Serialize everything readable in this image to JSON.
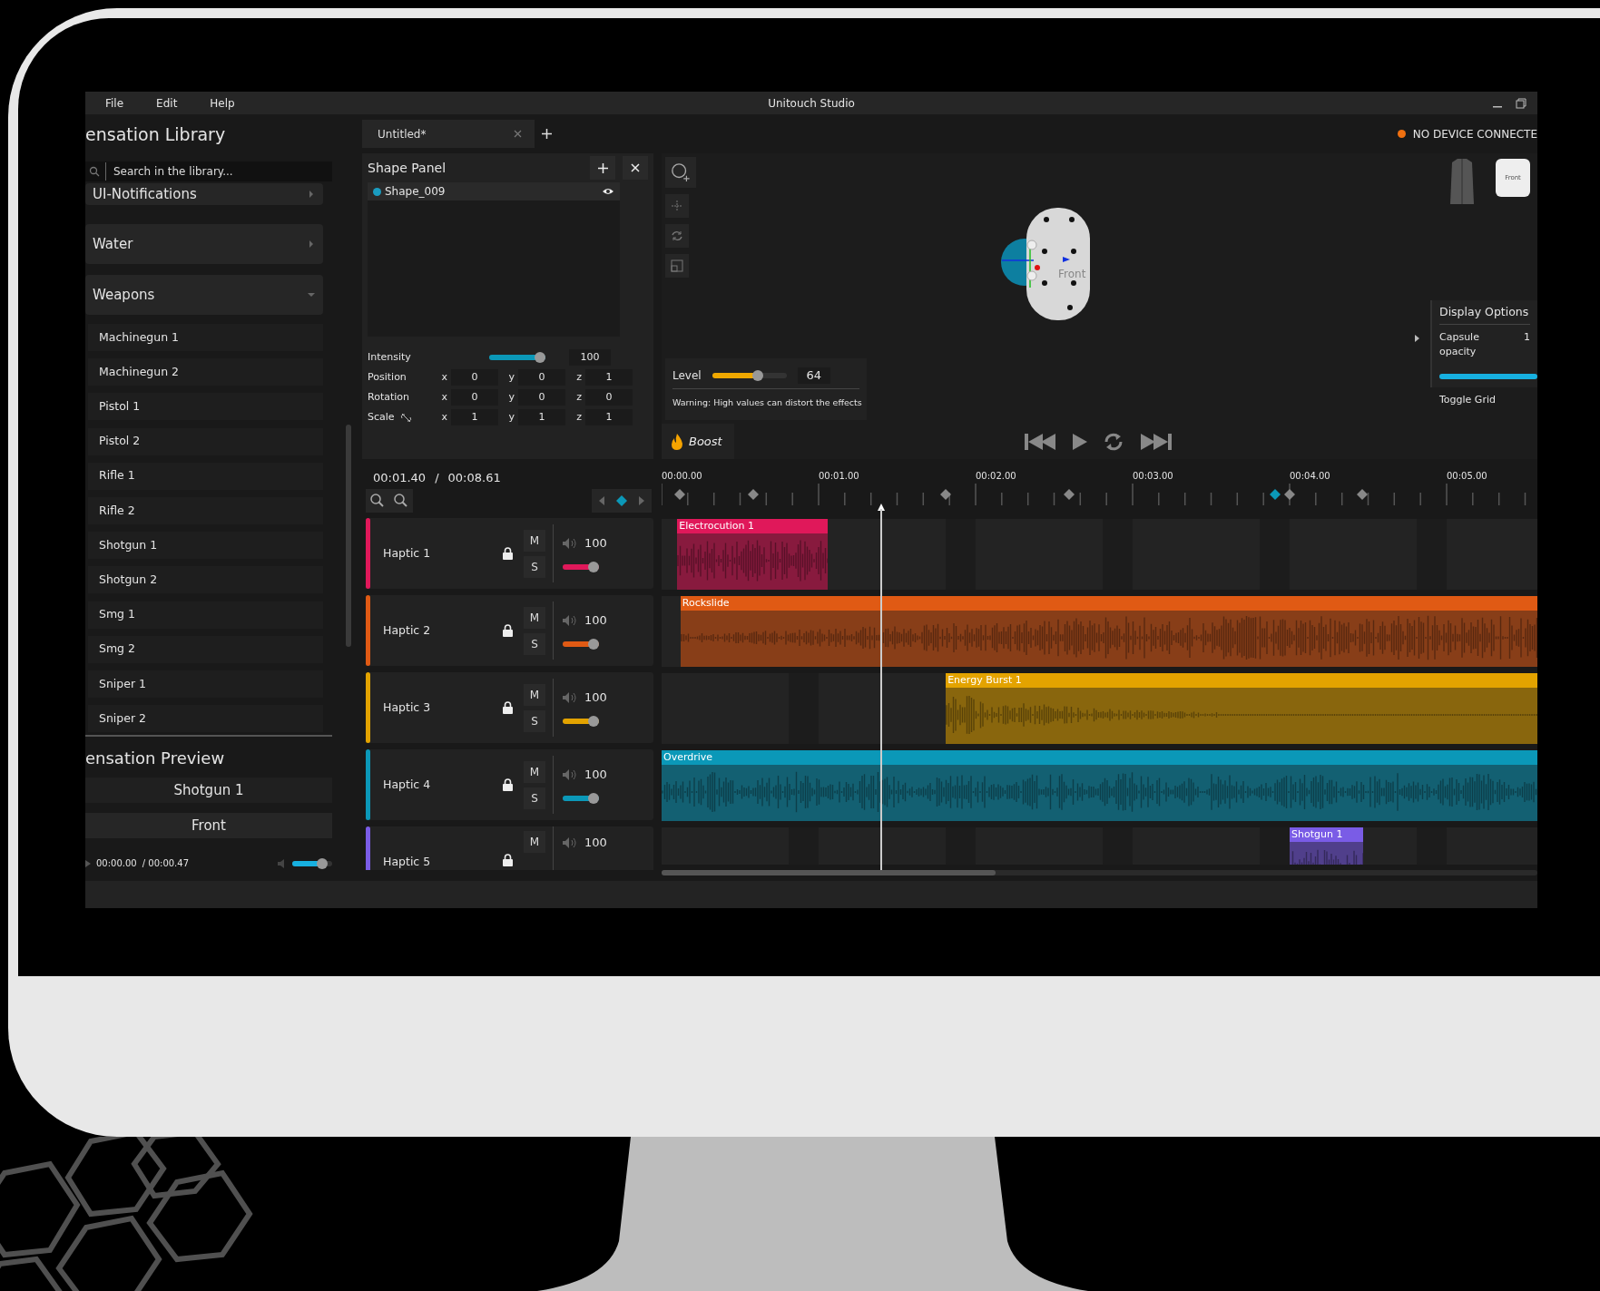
{
  "window": {
    "menu": [
      "File",
      "Edit",
      "Help"
    ],
    "title": "Unitouch Studio"
  },
  "library": {
    "title": "ensation Library",
    "search": {
      "placeholder": "Search in the library..."
    },
    "categories": [
      {
        "label": "UI-Notifications",
        "expanded": false
      },
      {
        "label": "Water",
        "expanded": false
      },
      {
        "label": "Weapons",
        "expanded": true,
        "items": [
          "Machinegun 1",
          "Machinegun 2",
          "Pistol 1",
          "Pistol 2",
          "Rifle 1",
          "Rifle 2",
          "Shotgun 1",
          "Shotgun 2",
          "Smg 1",
          "Smg 2",
          "Sniper 1",
          "Sniper 2"
        ]
      }
    ]
  },
  "preview": {
    "title": "ensation Preview",
    "sensation": "Shotgun 1",
    "view": "Front",
    "time": "00:00.00",
    "duration": "/ 00:00.47",
    "volume": {
      "level": 0.85
    }
  },
  "tabs": [
    {
      "label": "Untitled*",
      "selected": true
    }
  ],
  "device": {
    "label": "NO DEVICE CONNECTE",
    "connected": false
  },
  "shape_panel": {
    "title": "Shape Panel",
    "shapes": [
      {
        "name": "Shape_009",
        "color": "#1a9cc0",
        "visible": true
      }
    ],
    "intensity": {
      "label": "Intensity",
      "level": 1,
      "value": "100"
    },
    "transforms": [
      {
        "label": "Position",
        "values": [
          {
            "axis": "x",
            "value": "0"
          },
          {
            "axis": "y",
            "value": "0"
          },
          {
            "axis": "z",
            "value": "1"
          }
        ]
      },
      {
        "label": "Rotation",
        "values": [
          {
            "axis": "x",
            "value": "0"
          },
          {
            "axis": "y",
            "value": "0"
          },
          {
            "axis": "z",
            "value": "0"
          }
        ]
      },
      {
        "label": "Scale",
        "linked": false,
        "values": [
          {
            "axis": "x",
            "value": "1"
          },
          {
            "axis": "y",
            "value": "1"
          },
          {
            "axis": "z",
            "value": "1"
          }
        ]
      }
    ]
  },
  "viewport": {
    "model_label": "Front",
    "minimap_label": "Front",
    "level": {
      "label": "Level",
      "level": 0.64,
      "value": "64",
      "warning": "Warning: High values can distort the effects"
    },
    "display_options": {
      "title": "Display Options",
      "capsule_opacity": {
        "label": "Capsule opacity",
        "value": "1",
        "level": 1
      },
      "toggle_grid": "Toggle Grid"
    },
    "boost": "Boost"
  },
  "timeline": {
    "current_time": "00:01.40",
    "separator": "/",
    "total_time": "00:08.61",
    "ruler": [
      "00:00.00",
      "00:01.00",
      "00:02.00",
      "00:03.00",
      "00:04.00",
      "00:05.00"
    ],
    "tracks": [
      {
        "name": "Haptic 1",
        "color": "#e0185a",
        "locked": true,
        "mute": "M",
        "solo": "S",
        "volume": "100",
        "level": 1,
        "clip": "Electrocution 1"
      },
      {
        "name": "Haptic 2",
        "color": "#e05a14",
        "locked": true,
        "mute": "M",
        "solo": "S",
        "volume": "100",
        "level": 1,
        "clip": "Rockslide"
      },
      {
        "name": "Haptic 3",
        "color": "#e3a300",
        "locked": true,
        "mute": "M",
        "solo": "S",
        "volume": "100",
        "level": 1,
        "clip": "Energy Burst 1"
      },
      {
        "name": "Haptic 4",
        "color": "#0b98b8",
        "locked": true,
        "mute": "M",
        "solo": "S",
        "volume": "100",
        "level": 1,
        "clip": "Overdrive"
      },
      {
        "name": "Haptic 5",
        "color": "#7a5ce6",
        "locked": true,
        "mute": "M",
        "volume": "100",
        "clip": "Shotgun 1"
      }
    ]
  }
}
